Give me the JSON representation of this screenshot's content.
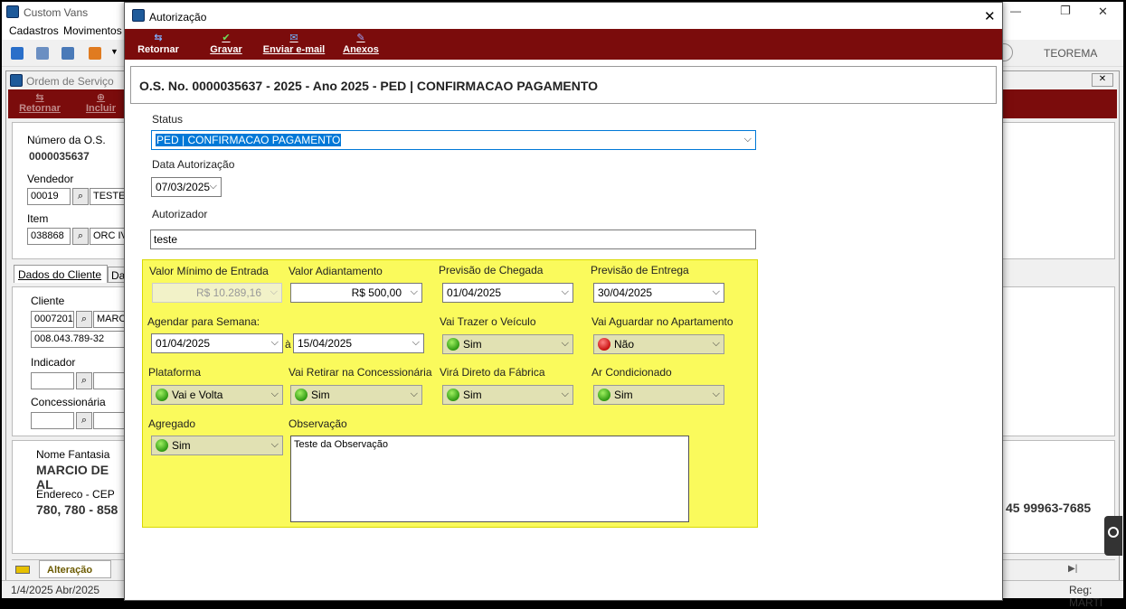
{
  "main": {
    "title": "Custom Vans",
    "menu": [
      "Cadastros",
      "Movimentos"
    ],
    "toolbar_right_label": "TEOREMA",
    "window_controls": {
      "minimize": "—",
      "restore": "❐",
      "close": "✕"
    }
  },
  "os_window": {
    "title": "Ordem de Serviço",
    "close": "✕",
    "toolbar": {
      "retornar": "Retornar",
      "incluir": "Incluir"
    },
    "numero_label": "Número da O.S.",
    "numero_value": "0000035637",
    "vendedor_label": "Vendedor",
    "vendedor_code": "00019",
    "vendedor_name": "TESTE",
    "item_label": "Item",
    "item_code": "038868",
    "item_name": "ORC IVE",
    "tabs": [
      "Dados do Cliente",
      "Da"
    ],
    "cliente_label": "Cliente",
    "cliente_code": "0007201",
    "cliente_name": "MARCIO",
    "cliente_doc": "008.043.789-32",
    "indicador_label": "Indicador",
    "concessionaria_label": "Concessionária",
    "nome_fantasia_label": "Nome Fantasia",
    "nome_fantasia_value": "MARCIO DE AL",
    "endereco_label": "Endereco - CEP",
    "endereco_value": "780, 780 - 858",
    "phone_value": "45 99963-7685",
    "status_tab": "Alteração",
    "statusbar_left": "1/4/2025 Abr/2025",
    "statusbar_right": "Reg: MARTI"
  },
  "dialog": {
    "title": "Autorização",
    "close": "✕",
    "toolbar": {
      "retornar": "Retornar",
      "gravar": "Gravar",
      "email": "Enviar e-mail",
      "anexos": "Anexos"
    },
    "header": "O.S. No. 0000035637 -  2025 - Ano 2025 - PED | CONFIRMACAO PAGAMENTO",
    "status_label": "Status",
    "status_value": "PED | CONFIRMACAO PAGAMENTO",
    "data_label": "Data Autorização",
    "data_value": "07/03/2025",
    "autorizador_label": "Autorizador",
    "autorizador_value": "teste",
    "fields": {
      "valor_minimo_label": "Valor Mínimo de Entrada",
      "valor_minimo_value": "R$ 10.289,16",
      "valor_adiantamento_label": "Valor Adiantamento",
      "valor_adiantamento_value": "R$ 500,00",
      "previsao_chegada_label": "Previsão de Chegada",
      "previsao_chegada_value": "01/04/2025",
      "previsao_entrega_label": "Previsão de Entrega",
      "previsao_entrega_value": "30/04/2025",
      "agendar_label": "Agendar para Semana:",
      "agendar_from": "01/04/2025",
      "agendar_sep": "à",
      "agendar_to": "15/04/2025",
      "trazer_label": "Vai Trazer o Veículo",
      "trazer_value": "Sim",
      "aguardar_label": "Vai Aguardar no Apartamento",
      "aguardar_value": "Não",
      "plataforma_label": "Plataforma",
      "plataforma_value": "Vai e Volta",
      "retirar_label": "Vai Retirar na Concessionária",
      "retirar_value": "Sim",
      "fabrica_label": "Virá Direto da Fábrica",
      "fabrica_value": "Sim",
      "ar_label": "Ar Condicionado",
      "ar_value": "Sim",
      "agregado_label": "Agregado",
      "agregado_value": "Sim",
      "observacao_label": "Observação",
      "observacao_value": "Teste da Observação"
    }
  },
  "colors": {
    "toolbar_red": "#7b0c0c",
    "highlight_yellow": "#fafa5c",
    "status_on": "#2f9a12",
    "status_off": "#c81010",
    "selection_blue": "#0078d7"
  }
}
